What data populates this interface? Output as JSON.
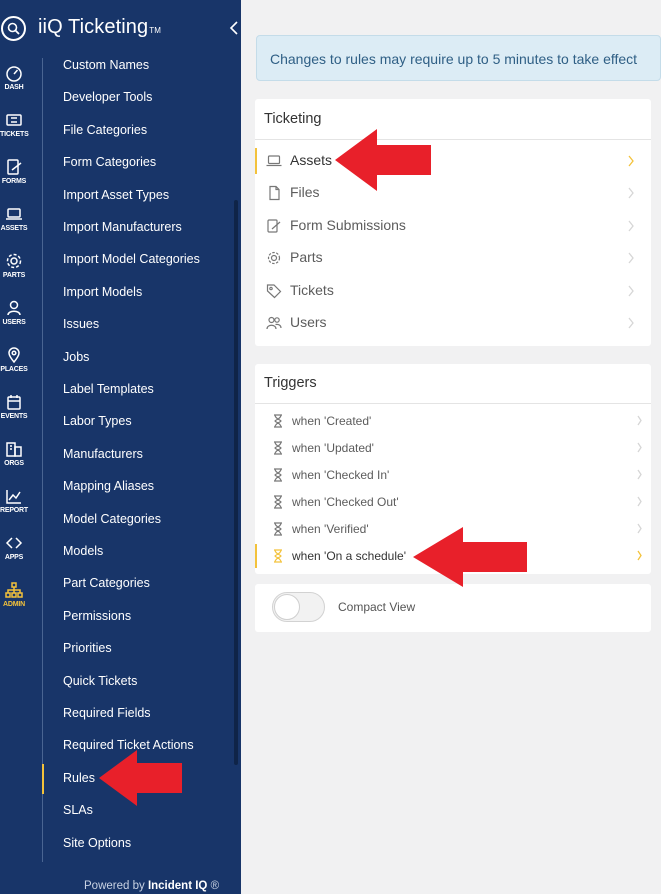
{
  "app": {
    "title": "iiQ Ticketing",
    "tm": "TM"
  },
  "rail": [
    {
      "label": "DASH",
      "icon": "gauge-icon"
    },
    {
      "label": "TICKETS",
      "icon": "ticket-icon"
    },
    {
      "label": "FORMS",
      "icon": "form-icon"
    },
    {
      "label": "ASSETS",
      "icon": "laptop-icon"
    },
    {
      "label": "PARTS",
      "icon": "gear-icon"
    },
    {
      "label": "USERS",
      "icon": "user-icon"
    },
    {
      "label": "PLACES",
      "icon": "location-pin-icon"
    },
    {
      "label": "EVENTS",
      "icon": "calendar-icon"
    },
    {
      "label": "ORGS",
      "icon": "building-icon"
    },
    {
      "label": "REPORT",
      "icon": "chart-icon"
    },
    {
      "label": "APPS",
      "icon": "apps-icon"
    },
    {
      "label": "ADMIN",
      "icon": "org-chart-icon",
      "active": true
    }
  ],
  "nav": {
    "items": [
      "Custom Names",
      "Developer Tools",
      "File Categories",
      "Form Categories",
      "Import Asset Types",
      "Import Manufacturers",
      "Import Model Categories",
      "Import Models",
      "Issues",
      "Jobs",
      "Label Templates",
      "Labor Types",
      "Manufacturers",
      "Mapping Aliases",
      "Model Categories",
      "Models",
      "Part Categories",
      "Permissions",
      "Priorities",
      "Quick Tickets",
      "Required Fields",
      "Required Ticket Actions",
      "Rules",
      "SLAs",
      "Site Options"
    ],
    "active": "Rules"
  },
  "footer": {
    "powered_by": "Powered by",
    "brand": "Incident IQ",
    "reg": "®"
  },
  "notice": {
    "text": "Changes to rules may require up to 5 minutes to take effect"
  },
  "ticketing": {
    "title": "Ticketing",
    "items": [
      {
        "label": "Assets",
        "icon": "laptop-icon",
        "active": true
      },
      {
        "label": "Files",
        "icon": "file-icon"
      },
      {
        "label": "Form Submissions",
        "icon": "form-icon"
      },
      {
        "label": "Parts",
        "icon": "gear-icon"
      },
      {
        "label": "Tickets",
        "icon": "tag-icon"
      },
      {
        "label": "Users",
        "icon": "users-icon"
      }
    ]
  },
  "triggers": {
    "title": "Triggers",
    "items": [
      {
        "label": "when 'Created'"
      },
      {
        "label": "when 'Updated'"
      },
      {
        "label": "when 'Checked In'"
      },
      {
        "label": "when 'Checked Out'"
      },
      {
        "label": "when 'Verified'"
      },
      {
        "label": "when 'On a schedule'",
        "active": true
      }
    ]
  },
  "compact_view": {
    "label": "Compact View",
    "enabled": false
  },
  "colors": {
    "sidebar": "#183569",
    "accent": "#f3c23b",
    "annotation_arrow": "#e8202a"
  }
}
